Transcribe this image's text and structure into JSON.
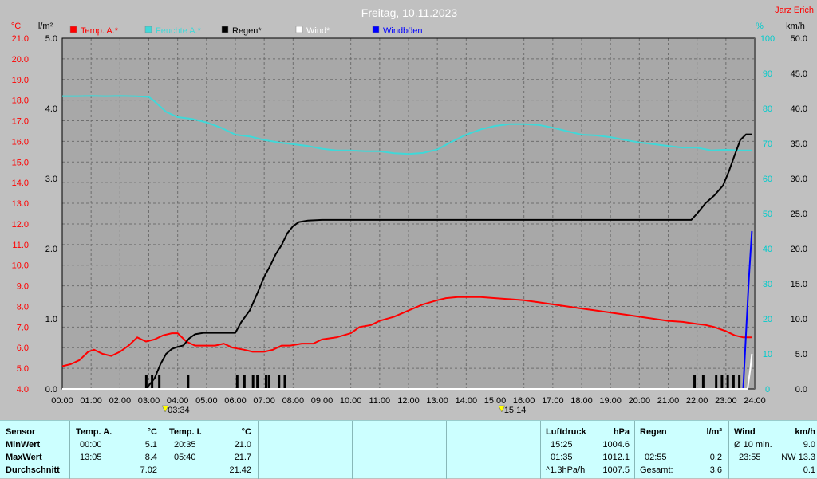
{
  "chart_data": {
    "type": "line",
    "title": "Freitag, 10.11.2023",
    "corner_label": "Jarz Erich",
    "x_ticks": [
      "00:00",
      "01:00",
      "02:00",
      "03:00",
      "04:00",
      "05:00",
      "06:00",
      "07:00",
      "08:00",
      "09:00",
      "10:00",
      "11:00",
      "12:00",
      "13:00",
      "14:00",
      "15:00",
      "16:00",
      "17:00",
      "18:00",
      "19:00",
      "20:00",
      "21:00",
      "22:00",
      "23:00",
      "24:00"
    ],
    "xlim": [
      0,
      24
    ],
    "axes": {
      "temp": {
        "unit": "°C",
        "ylim": [
          4,
          21
        ],
        "ticks": [
          "4.0",
          "5.0",
          "6.0",
          "7.0",
          "8.0",
          "9.0",
          "10.0",
          "11.0",
          "12.0",
          "13.0",
          "14.0",
          "15.0",
          "16.0",
          "17.0",
          "18.0",
          "19.0",
          "20.0",
          "21.0"
        ],
        "color": "#ff0000"
      },
      "rain": {
        "unit": "l/m²",
        "ylim": [
          0,
          5
        ],
        "ticks": [
          "0.0",
          "1.0",
          "2.0",
          "3.0",
          "4.0",
          "5.0"
        ],
        "color": "#000000"
      },
      "humidity": {
        "unit": "%",
        "ylim": [
          0,
          100
        ],
        "ticks": [
          "0",
          "10",
          "20",
          "30",
          "40",
          "50",
          "60",
          "70",
          "80",
          "90",
          "100"
        ],
        "color": "#00cccc"
      },
      "wind": {
        "unit": "km/h",
        "ylim": [
          0,
          50
        ],
        "ticks": [
          "0.0",
          "5.0",
          "10.0",
          "15.0",
          "20.0",
          "25.0",
          "30.0",
          "35.0",
          "40.0",
          "45.0",
          "50.0"
        ],
        "color": "#000000"
      }
    },
    "grid": true,
    "legend_position": "top-left",
    "series": [
      {
        "name": "Temp. A.*",
        "axis": "temp",
        "color": "#ff0000",
        "x": [
          0,
          0.3,
          0.6,
          0.9,
          1.1,
          1.4,
          1.7,
          2.0,
          2.3,
          2.6,
          2.9,
          3.2,
          3.5,
          3.8,
          4.0,
          4.3,
          4.6,
          5.0,
          5.3,
          5.6,
          5.9,
          6.3,
          6.6,
          7.0,
          7.3,
          7.6,
          7.9,
          8.3,
          8.7,
          9.0,
          9.5,
          10.0,
          10.3,
          10.7,
          11.0,
          11.5,
          12.0,
          12.5,
          13.0,
          13.3,
          13.7,
          14.0,
          14.5,
          15.0,
          15.5,
          16.0,
          16.5,
          17.0,
          17.5,
          18.0,
          18.5,
          19.0,
          19.5,
          20.0,
          20.5,
          21.0,
          21.5,
          22.0,
          22.3,
          22.6,
          23.0,
          23.3,
          23.6,
          23.9
        ],
        "y": [
          5.1,
          5.2,
          5.4,
          5.8,
          5.9,
          5.7,
          5.6,
          5.8,
          6.1,
          6.5,
          6.3,
          6.4,
          6.6,
          6.7,
          6.7,
          6.3,
          6.1,
          6.1,
          6.1,
          6.2,
          6.0,
          5.9,
          5.8,
          5.8,
          5.9,
          6.1,
          6.1,
          6.2,
          6.2,
          6.4,
          6.5,
          6.7,
          7.0,
          7.1,
          7.3,
          7.5,
          7.8,
          8.1,
          8.3,
          8.4,
          8.45,
          8.45,
          8.45,
          8.4,
          8.35,
          8.3,
          8.2,
          8.1,
          8.0,
          7.9,
          7.8,
          7.7,
          7.6,
          7.5,
          7.4,
          7.3,
          7.25,
          7.15,
          7.1,
          7.0,
          6.8,
          6.6,
          6.5,
          6.5
        ]
      },
      {
        "name": "Feuchte A.*",
        "axis": "humidity",
        "color": "#40d8d8",
        "x": [
          0,
          0.5,
          1.0,
          1.5,
          2.0,
          2.5,
          3.0,
          3.2,
          3.6,
          4.0,
          4.5,
          5.0,
          5.5,
          6.0,
          6.5,
          7.0,
          7.5,
          8.0,
          8.5,
          9.0,
          9.5,
          10.0,
          10.5,
          11.0,
          11.5,
          12.0,
          12.5,
          13.0,
          13.5,
          14.0,
          14.5,
          15.0,
          15.5,
          16.0,
          16.5,
          17.0,
          17.5,
          18.0,
          18.5,
          19.0,
          19.5,
          20.0,
          20.5,
          21.0,
          21.5,
          22.0,
          22.5,
          23.0,
          23.5,
          23.9
        ],
        "y": [
          83.5,
          83.5,
          83.6,
          83.5,
          83.6,
          83.5,
          83.3,
          82,
          79,
          77.5,
          77,
          76,
          74.5,
          72.5,
          72,
          71,
          70.3,
          69.8,
          69.3,
          68.5,
          68,
          68,
          67.8,
          67.8,
          67.2,
          67,
          67.3,
          68.3,
          70.5,
          72.5,
          74,
          75,
          75.5,
          75.5,
          75.3,
          74.5,
          73.5,
          72.5,
          72.3,
          71.8,
          71,
          70.3,
          69.8,
          69.3,
          68.8,
          68.8,
          68,
          68.2,
          68,
          68
        ]
      },
      {
        "name": "Regen*",
        "axis": "rain",
        "color": "#000000",
        "x": [
          0,
          2.9,
          3.0,
          3.2,
          3.4,
          3.6,
          3.8,
          4.0,
          4.2,
          4.4,
          4.6,
          4.9,
          5.2,
          5.6,
          6.0,
          6.2,
          6.5,
          6.8,
          7.0,
          7.2,
          7.4,
          7.6,
          7.8,
          8.0,
          8.2,
          8.5,
          9.0,
          10,
          12,
          14,
          16,
          18,
          20,
          21.8,
          22.0,
          22.3,
          22.6,
          22.9,
          23.1,
          23.3,
          23.5,
          23.7,
          23.9
        ],
        "y": [
          0,
          0,
          0.05,
          0.15,
          0.35,
          0.5,
          0.57,
          0.6,
          0.62,
          0.72,
          0.78,
          0.8,
          0.8,
          0.8,
          0.8,
          0.95,
          1.12,
          1.4,
          1.6,
          1.75,
          1.92,
          2.05,
          2.22,
          2.32,
          2.38,
          2.4,
          2.41,
          2.41,
          2.41,
          2.41,
          2.41,
          2.41,
          2.41,
          2.41,
          2.5,
          2.65,
          2.76,
          2.9,
          3.1,
          3.33,
          3.55,
          3.63,
          3.63
        ]
      },
      {
        "name": "Wind*",
        "axis": "wind",
        "color": "#ffffff",
        "x": [
          0,
          23.75,
          23.85,
          23.9
        ],
        "y": [
          0,
          0,
          3,
          5
        ]
      },
      {
        "name": "Windböen",
        "axis": "wind",
        "color": "#0000ff",
        "x": [
          0,
          23.6,
          23.7,
          23.8,
          23.9
        ],
        "y": [
          0,
          0,
          8,
          16,
          22.5
        ]
      }
    ],
    "rain_ticks_x": [
      2.9,
      3.1,
      3.35,
      4.35,
      6.05,
      6.3,
      6.6,
      6.75,
      7.05,
      7.15,
      7.5,
      7.7,
      21.9,
      22.2,
      22.65,
      22.85,
      23.05,
      23.25,
      23.45
    ],
    "sun_markers": [
      {
        "label": "03:34",
        "x": 3.57
      },
      {
        "label": "15:14",
        "x": 15.23
      }
    ]
  },
  "table": {
    "sensor": {
      "header": "Sensor",
      "rows": [
        "MinWert",
        "MaxWert",
        "Durchschnitt"
      ]
    },
    "temp_a": {
      "header": "Temp. A.",
      "unit": "°C",
      "min_time": "00:00",
      "min_value": "5.1",
      "max_time": "13:05",
      "max_value": "8.4",
      "avg": "7.02"
    },
    "temp_i": {
      "header": "Temp. I.",
      "unit": "°C",
      "min_time": "20:35",
      "min_value": "21.0",
      "max_time": "05:40",
      "max_value": "21.7",
      "avg": "21.42"
    },
    "luftdruck": {
      "header": "Luftdruck",
      "unit": "hPa",
      "min_time": "15:25",
      "min_value": "1004.6",
      "max_time": "01:35",
      "max_value": "1012.1",
      "trend": "^1.3hPa/h",
      "avg": "1007.5"
    },
    "regen": {
      "header": "Regen",
      "unit": "l/m²",
      "max_time": "02:55",
      "max_value": "0.2",
      "total_label": "Gesamt:",
      "total": "3.6"
    },
    "wind": {
      "header": "Wind",
      "unit": "km/h",
      "avg10_label": "Ø 10 min.",
      "avg10": "9.0",
      "max_time": "23:55",
      "max_value": "NW 13.3",
      "avg": "0.1"
    }
  }
}
